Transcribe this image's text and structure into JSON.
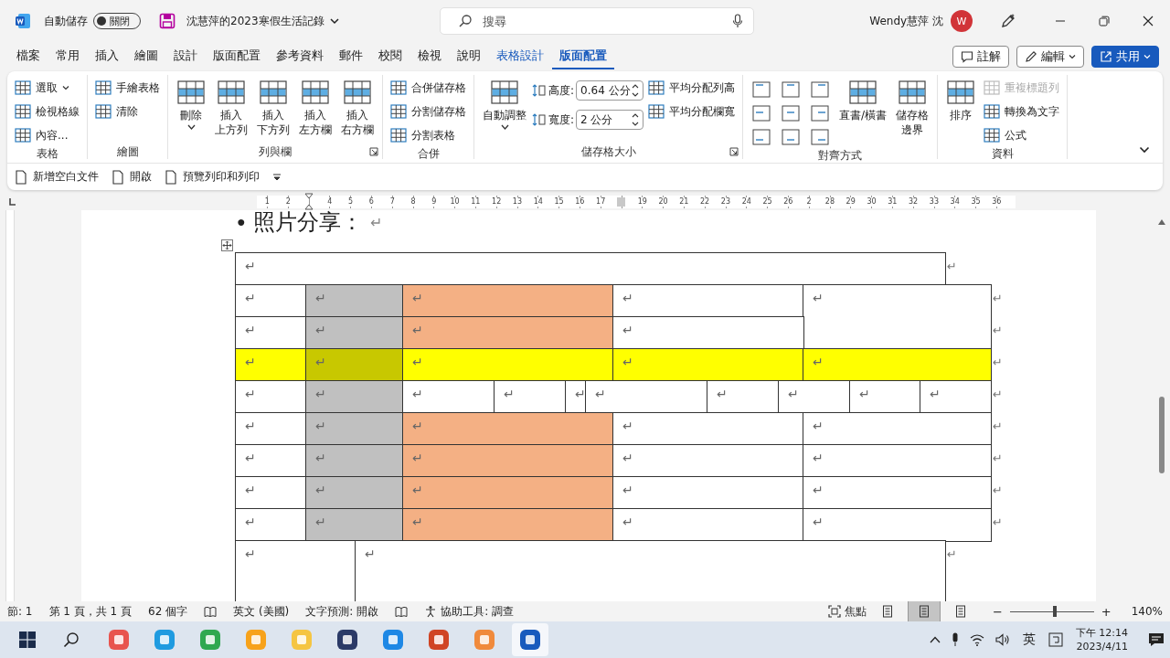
{
  "titlebar": {
    "autosave_label": "自動儲存",
    "autosave": {
      "on": false,
      "label": "關閉"
    },
    "document_title": "沈慧萍的2023寒假生活記錄",
    "search": {
      "placeholder": "搜尋"
    },
    "user_name": "Wendy慧萍 沈",
    "avatar": "W"
  },
  "tabs": [
    {
      "label": "檔案",
      "selected": false,
      "kind": "normal"
    },
    {
      "label": "常用",
      "selected": false,
      "kind": "normal"
    },
    {
      "label": "插入",
      "selected": false,
      "kind": "normal"
    },
    {
      "label": "繪圖",
      "selected": false,
      "kind": "normal"
    },
    {
      "label": "設計",
      "selected": false,
      "kind": "normal"
    },
    {
      "label": "版面配置",
      "selected": false,
      "kind": "normal"
    },
    {
      "label": "參考資料",
      "selected": false,
      "kind": "normal"
    },
    {
      "label": "郵件",
      "selected": false,
      "kind": "normal"
    },
    {
      "label": "校閱",
      "selected": false,
      "kind": "normal"
    },
    {
      "label": "檢視",
      "selected": false,
      "kind": "normal"
    },
    {
      "label": "說明",
      "selected": false,
      "kind": "normal"
    },
    {
      "label": "表格設計",
      "selected": false,
      "kind": "contextual"
    },
    {
      "label": "版面配置",
      "selected": true,
      "kind": "contextual"
    }
  ],
  "actions": [
    {
      "label": "註解",
      "kind": "outline"
    },
    {
      "label": "編輯",
      "kind": "outline-menu"
    },
    {
      "label": "共用",
      "kind": "primary"
    }
  ],
  "ribbon": {
    "groups": [
      {
        "label": "表格",
        "launcher": false,
        "columns": [
          [
            {
              "kind": "small",
              "label": "選取",
              "caret": true
            },
            {
              "kind": "small",
              "label": "檢視格線",
              "caret": false
            },
            {
              "kind": "small",
              "label": "內容...",
              "caret": false
            }
          ]
        ]
      },
      {
        "label": "繪圖",
        "launcher": false,
        "columns": [
          [
            {
              "kind": "small",
              "label": "手繪表格",
              "caret": false
            },
            {
              "kind": "small",
              "label": "清除",
              "caret": false
            }
          ]
        ]
      },
      {
        "label": "列與欄",
        "launcher": true,
        "columns": [
          [
            {
              "kind": "large",
              "lines": [
                "刪除"
              ],
              "caret": true
            }
          ],
          [
            {
              "kind": "large",
              "lines": [
                "插入",
                "上方列"
              ],
              "caret": false
            }
          ],
          [
            {
              "kind": "large",
              "lines": [
                "插入",
                "下方列"
              ],
              "caret": false
            }
          ],
          [
            {
              "kind": "large",
              "lines": [
                "插入",
                "左方欄"
              ],
              "caret": false
            }
          ],
          [
            {
              "kind": "large",
              "lines": [
                "插入",
                "右方欄"
              ],
              "caret": false
            }
          ]
        ]
      },
      {
        "label": "合併",
        "launcher": false,
        "columns": [
          [
            {
              "kind": "small",
              "label": "合併儲存格",
              "caret": false
            },
            {
              "kind": "small",
              "label": "分割儲存格",
              "caret": false
            },
            {
              "kind": "small",
              "label": "分割表格",
              "caret": false
            }
          ]
        ]
      },
      {
        "label": "儲存格大小",
        "launcher": true,
        "columns": [
          [
            {
              "kind": "large",
              "lines": [
                "自動調整"
              ],
              "caret": true
            }
          ],
          [
            {
              "kind": "field",
              "label": "高度:",
              "value": "0.64 公分"
            },
            {
              "kind": "field",
              "label": "寬度:",
              "value": "2 公分"
            }
          ],
          [
            {
              "kind": "small",
              "label": "平均分配列高",
              "caret": false
            },
            {
              "kind": "small",
              "label": "平均分配欄寬",
              "caret": false
            }
          ]
        ]
      },
      {
        "label": "對齊方式",
        "launcher": false,
        "columns": [
          [
            {
              "kind": "align-grid"
            }
          ],
          [
            {
              "kind": "large",
              "lines": [
                "直書/橫書"
              ],
              "caret": false
            }
          ],
          [
            {
              "kind": "large",
              "lines": [
                "儲存格",
                "邊界"
              ],
              "caret": false
            }
          ]
        ]
      },
      {
        "label": "資料",
        "launcher": false,
        "columns": [
          [
            {
              "kind": "large",
              "lines": [
                "排序"
              ],
              "caret": false
            }
          ],
          [
            {
              "kind": "small",
              "label": "重複標題列",
              "caret": false,
              "disabled": true
            },
            {
              "kind": "small",
              "label": "轉換為文字",
              "caret": false,
              "disabled": false
            },
            {
              "kind": "small",
              "label": "公式",
              "caret": false,
              "disabled": false
            }
          ]
        ]
      }
    ]
  },
  "quick_access": [
    {
      "label": "新增空白文件"
    },
    {
      "label": "開啟"
    },
    {
      "label": "預覽列印和列印"
    }
  ],
  "ruler": {
    "slots": [
      {
        "kind": "number",
        "text": "1"
      },
      {
        "kind": "number",
        "text": "2"
      },
      {
        "kind": "indent-marker"
      },
      {
        "kind": "number",
        "text": "4"
      },
      {
        "kind": "number",
        "text": "5"
      },
      {
        "kind": "number",
        "text": "6"
      },
      {
        "kind": "number",
        "text": "7"
      },
      {
        "kind": "number",
        "text": "8"
      },
      {
        "kind": "number",
        "text": "9"
      },
      {
        "kind": "number",
        "text": "10"
      },
      {
        "kind": "number",
        "text": "11"
      },
      {
        "kind": "number",
        "text": "12"
      },
      {
        "kind": "number",
        "text": "13"
      },
      {
        "kind": "number",
        "text": "14"
      },
      {
        "kind": "number",
        "text": "15"
      },
      {
        "kind": "number",
        "text": "16"
      },
      {
        "kind": "number",
        "text": "17"
      },
      {
        "kind": "column-marker"
      },
      {
        "kind": "number",
        "text": "19"
      },
      {
        "kind": "number",
        "text": "20"
      },
      {
        "kind": "number",
        "text": "21"
      },
      {
        "kind": "number",
        "text": "22"
      },
      {
        "kind": "number",
        "text": "23"
      },
      {
        "kind": "number",
        "text": "24"
      },
      {
        "kind": "number",
        "text": "25"
      },
      {
        "kind": "number",
        "text": "26"
      },
      {
        "kind": "number",
        "text": "2"
      },
      {
        "kind": "number",
        "text": "28"
      },
      {
        "kind": "number",
        "text": "29"
      },
      {
        "kind": "number",
        "text": "30"
      },
      {
        "kind": "number",
        "text": "31"
      },
      {
        "kind": "number",
        "text": "32"
      },
      {
        "kind": "number",
        "text": "33"
      },
      {
        "kind": "number",
        "text": "34"
      },
      {
        "kind": "number",
        "text": "35"
      },
      {
        "kind": "number",
        "text": "36"
      }
    ]
  },
  "document": {
    "bullet": "●",
    "heading": "照片分享：",
    "heading_mark": "↵",
    "table": {
      "rows": [
        {
          "end_mark": "↵",
          "cells": [
            {
              "mark": "↵",
              "color": "#ffffff"
            }
          ]
        },
        {
          "end_mark": "↵",
          "cells": [
            {
              "mark": "↵",
              "color": "#ffffff"
            },
            {
              "mark": "↵",
              "color": "#c0c0c0"
            },
            {
              "mark": "↵",
              "color": "#f4b084"
            },
            {
              "mark": "↵",
              "color": "#ffffff"
            },
            {
              "mark": "↵",
              "color": "#ffffff"
            }
          ]
        },
        {
          "end_mark": "↵",
          "cells": [
            {
              "mark": "↵",
              "color": "#ffffff"
            },
            {
              "mark": "↵",
              "color": "#c0c0c0"
            },
            {
              "mark": "↵",
              "color": "#f4b084"
            },
            {
              "mark": "↵",
              "color": "#ffffff"
            }
          ]
        },
        {
          "end_mark": "↵",
          "cells": [
            {
              "mark": "↵",
              "color": "#ffff00"
            },
            {
              "mark": "↵",
              "color": "#c8c800"
            },
            {
              "mark": "↵",
              "color": "#ffff00"
            },
            {
              "mark": "↵",
              "color": "#ffff00"
            },
            {
              "mark": "↵",
              "color": "#ffff00"
            }
          ]
        },
        {
          "end_mark": "↵",
          "cells": [
            {
              "mark": "↵",
              "color": "#ffffff"
            },
            {
              "mark": "↵",
              "color": "#c0c0c0"
            },
            {
              "mark": "↵",
              "color": "#ffffff"
            },
            {
              "mark": "↵",
              "color": "#ffffff"
            },
            {
              "mark": "↵",
              "color": "#ffffff"
            },
            {
              "mark": "↵",
              "color": "#ffffff"
            },
            {
              "mark": "↵",
              "color": "#ffffff"
            },
            {
              "mark": "↵",
              "color": "#ffffff"
            },
            {
              "mark": "↵",
              "color": "#ffffff"
            },
            {
              "mark": "↵",
              "color": "#ffffff"
            }
          ]
        },
        {
          "end_mark": "↵",
          "cells": [
            {
              "mark": "↵",
              "color": "#ffffff"
            },
            {
              "mark": "↵",
              "color": "#c0c0c0"
            },
            {
              "mark": "↵",
              "color": "#f4b084"
            },
            {
              "mark": "↵",
              "color": "#ffffff"
            },
            {
              "mark": "↵",
              "color": "#ffffff"
            }
          ]
        },
        {
          "end_mark": "↵",
          "cells": [
            {
              "mark": "↵",
              "color": "#ffffff"
            },
            {
              "mark": "↵",
              "color": "#c0c0c0"
            },
            {
              "mark": "↵",
              "color": "#f4b084"
            },
            {
              "mark": "↵",
              "color": "#ffffff"
            },
            {
              "mark": "↵",
              "color": "#ffffff"
            }
          ]
        },
        {
          "end_mark": "↵",
          "cells": [
            {
              "mark": "↵",
              "color": "#ffffff"
            },
            {
              "mark": "↵",
              "color": "#c0c0c0"
            },
            {
              "mark": "↵",
              "color": "#f4b084"
            },
            {
              "mark": "↵",
              "color": "#ffffff"
            },
            {
              "mark": "↵",
              "color": "#ffffff"
            }
          ]
        },
        {
          "end_mark": "↵",
          "cells": [
            {
              "mark": "↵",
              "color": "#ffffff"
            },
            {
              "mark": "↵",
              "color": "#c0c0c0"
            },
            {
              "mark": "↵",
              "color": "#f4b084"
            },
            {
              "mark": "↵",
              "color": "#ffffff"
            },
            {
              "mark": "↵",
              "color": "#ffffff"
            }
          ]
        },
        {
          "end_mark": "↵",
          "cells": [
            {
              "mark": "↵",
              "color": "#ffffff"
            },
            {
              "mark": "↵",
              "color": "#ffffff"
            }
          ]
        }
      ]
    }
  },
  "status_bar": {
    "left": [
      {
        "kind": "text",
        "label": "節: 1"
      },
      {
        "kind": "text",
        "label": "第 1 頁，共 1 頁"
      },
      {
        "kind": "text",
        "label": "62 個字"
      },
      {
        "kind": "icon"
      },
      {
        "kind": "text",
        "label": "英文 (美國)"
      },
      {
        "kind": "text",
        "label": "文字預測: 開啟"
      },
      {
        "kind": "icon"
      },
      {
        "kind": "icon-text",
        "label": "協助工具: 調查"
      }
    ],
    "focus": "焦點",
    "views": [
      {
        "selected": false
      },
      {
        "selected": true
      },
      {
        "selected": false
      }
    ],
    "zoom": {
      "minus": "−",
      "plus": "+",
      "level": 0.53,
      "reading": "140%"
    }
  },
  "taskbar": {
    "apps": [
      {
        "color": "#e8544e",
        "selected": false
      },
      {
        "color": "#1f9be0",
        "selected": false
      },
      {
        "color": "#2fa84f",
        "selected": false
      },
      {
        "color": "#f7a21b",
        "selected": false
      },
      {
        "color": "#f5c542",
        "selected": false
      },
      {
        "color": "#2b3a67",
        "selected": false
      },
      {
        "color": "#1e88e5",
        "selected": false
      },
      {
        "color": "#d04423",
        "selected": false
      },
      {
        "color": "#f08a3c",
        "selected": false
      },
      {
        "color": "#185abd",
        "selected": true
      }
    ],
    "ime": "英",
    "time": "下午 12:14",
    "date": "2023/4/11"
  }
}
